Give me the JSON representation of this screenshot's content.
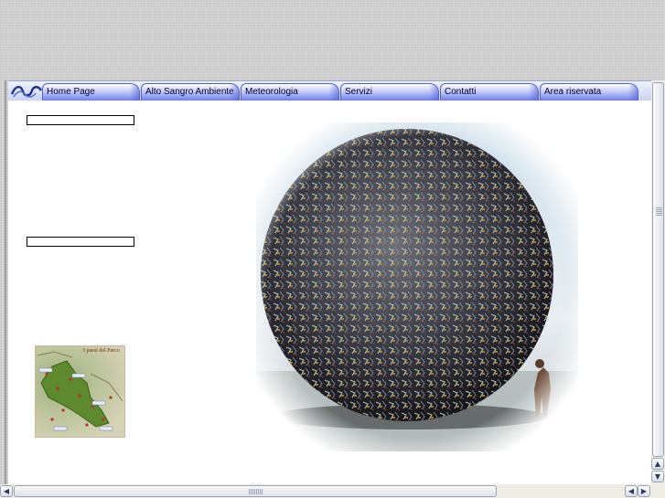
{
  "nav": {
    "logo_icon": "wave-logo-icon",
    "tabs": [
      {
        "label": "Home Page"
      },
      {
        "label": "Alto Sangro Ambiente"
      },
      {
        "label": "Meteorologia"
      },
      {
        "label": "Servizi"
      },
      {
        "label": "Contatti"
      },
      {
        "label": "Area riservata"
      }
    ]
  },
  "sidebar": {
    "map": {
      "title": "I paesi del Parco"
    }
  },
  "scrollbars": {
    "up_arrow": "▲",
    "down_arrow": "▼",
    "left_arrow": "◀",
    "right_arrow": "▶"
  },
  "colors": {
    "tab_gradient_end": "#6e7ff0",
    "tab_border": "#5260c8",
    "background_pattern": "#d4d4d4"
  }
}
